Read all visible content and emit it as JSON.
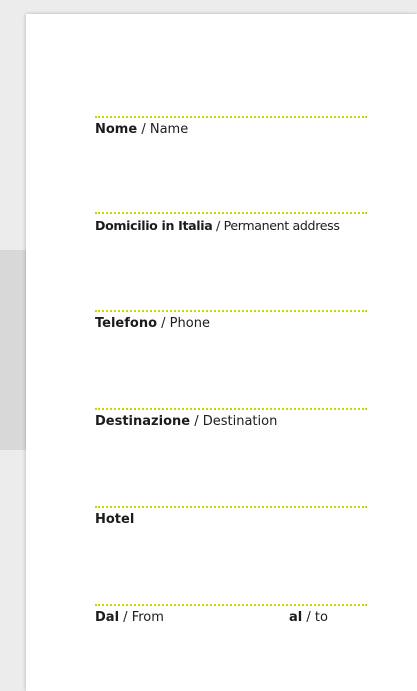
{
  "form": {
    "fields": [
      {
        "bold": "Nome",
        "sep": " / ",
        "english": "Name"
      },
      {
        "bold": "Domicilio in Italia",
        "sep": " / ",
        "english": "Permanent address"
      },
      {
        "bold": "Telefono",
        "sep": " / ",
        "english": "Phone"
      },
      {
        "bold": "Destinazione",
        "sep": " / ",
        "english": "Destination"
      },
      {
        "bold": "Hotel"
      },
      {
        "bold": "Dal",
        "sep": " / ",
        "english": "From"
      }
    ],
    "to_field": {
      "bold": "al",
      "sep": " / ",
      "english": "to"
    }
  },
  "colors": {
    "dotted_line": "#c8d400",
    "text": "#1c1c1c",
    "card": "#ffffff"
  }
}
